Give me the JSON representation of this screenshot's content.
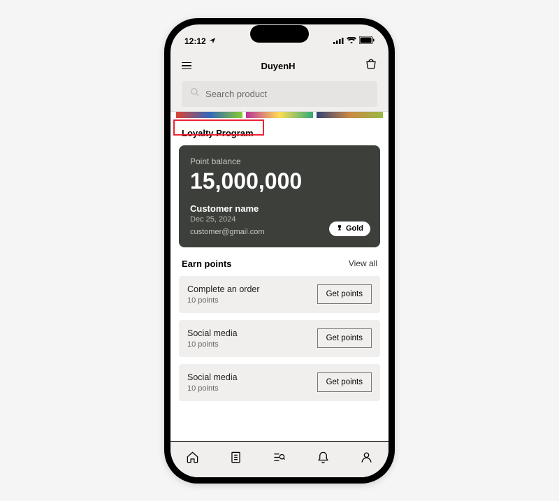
{
  "statusBar": {
    "time": "12:12"
  },
  "header": {
    "title": "DuyenH"
  },
  "search": {
    "placeholder": "Search product"
  },
  "loyalty": {
    "sectionTitle": "Loyalty Program",
    "pointLabel": "Point balance",
    "points": "15,000,000",
    "customerName": "Customer name",
    "date": "Dec 25, 2024",
    "email": "customer@gmail.com",
    "tier": "Gold"
  },
  "earn": {
    "title": "Earn points",
    "viewAll": "View all",
    "items": [
      {
        "name": "Complete an order",
        "pts": "10 points",
        "btn": "Get points"
      },
      {
        "name": "Social media",
        "pts": "10 points",
        "btn": "Get points"
      },
      {
        "name": "Social media",
        "pts": "10 points",
        "btn": "Get points"
      }
    ]
  }
}
